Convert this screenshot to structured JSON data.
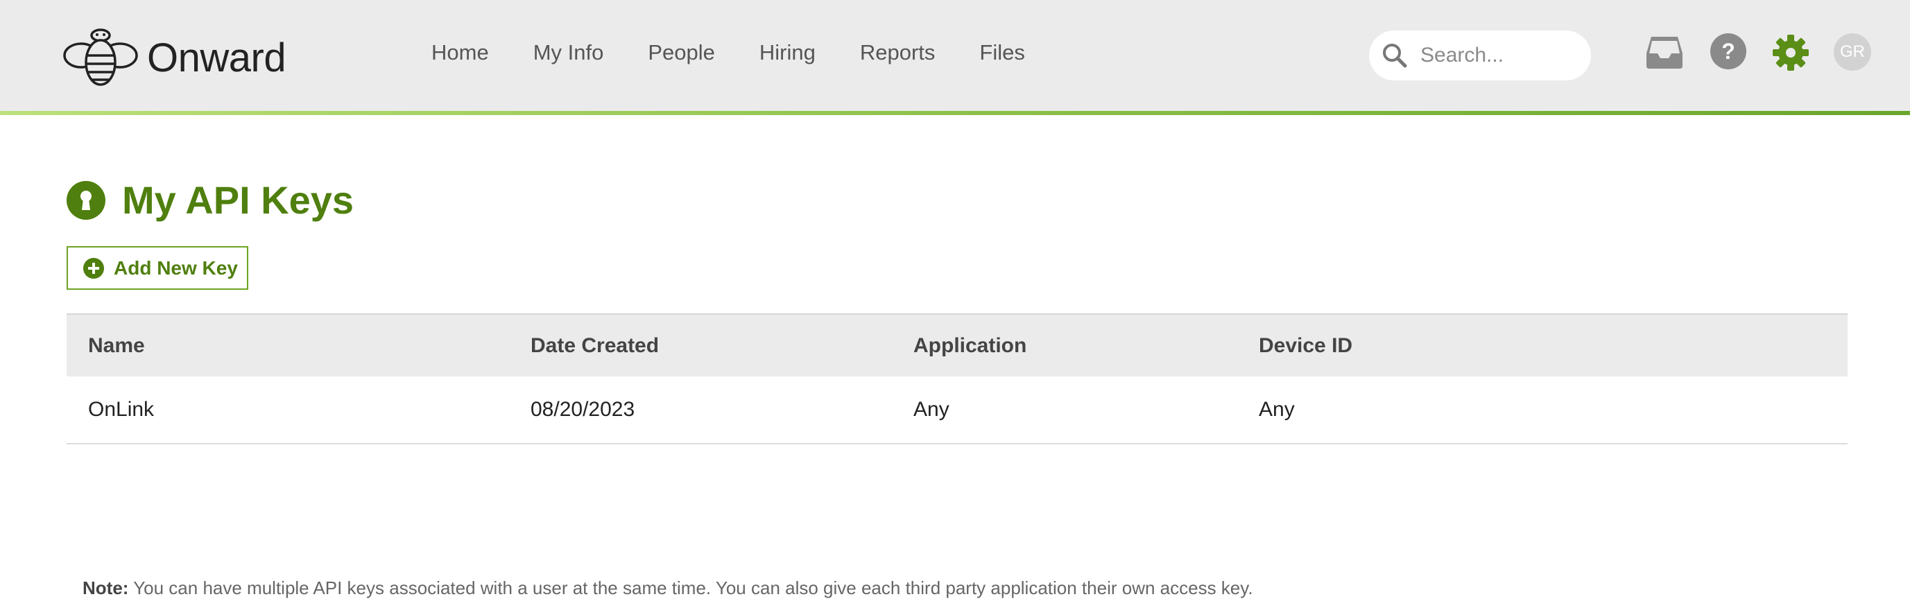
{
  "header": {
    "brand": "Onward",
    "nav": [
      "Home",
      "My Info",
      "People",
      "Hiring",
      "Reports",
      "Files"
    ],
    "search_placeholder": "Search...",
    "avatar_initials": "GR"
  },
  "page": {
    "title": "My API Keys",
    "add_button_label": "Add New Key"
  },
  "table": {
    "columns": [
      "Name",
      "Date Created",
      "Application",
      "Device ID"
    ],
    "rows": [
      [
        "OnLink",
        "08/20/2023",
        "Any",
        "Any"
      ]
    ]
  },
  "note": {
    "label": "Note:",
    "text": "You can have multiple API keys associated with a user at the same time. You can also give each third party application their own access key."
  },
  "colors": {
    "accent": "#4f7f0e",
    "header_bg": "#ebebeb",
    "settings_icon": "#5a8e16"
  },
  "icons": {
    "logo": "bee-logo-icon",
    "search": "search-icon",
    "inbox": "inbox-tray-icon",
    "help": "question-mark-icon",
    "settings": "gear-icon",
    "title": "keyhole-icon",
    "add": "plus-circle-icon"
  }
}
